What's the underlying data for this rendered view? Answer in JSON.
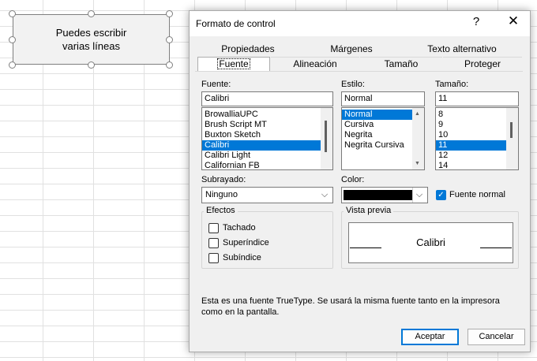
{
  "shape": {
    "text": "Puedes escribir\nvarias líneas"
  },
  "dialog": {
    "title": "Formato de control",
    "help": "?",
    "close": "✕",
    "tabs_row1": [
      "Propiedades",
      "Márgenes",
      "Texto alternativo"
    ],
    "tabs_row2": [
      "Fuente",
      "Alineación",
      "Tamaño",
      "Proteger"
    ],
    "font": {
      "label": "Fuente:",
      "value": "Calibri",
      "items": [
        "BrowalliaUPC",
        "Brush Script MT",
        "Buxton Sketch",
        "Calibri",
        "Calibri Light",
        "Californian FB"
      ],
      "selected": "Calibri"
    },
    "style": {
      "label": "Estilo:",
      "value": "Normal",
      "items": [
        "Normal",
        "Cursiva",
        "Negrita",
        "Negrita Cursiva"
      ],
      "selected": "Normal"
    },
    "size": {
      "label": "Tamaño:",
      "value": "11",
      "items": [
        "8",
        "9",
        "10",
        "11",
        "12",
        "14"
      ],
      "selected": "11"
    },
    "underline": {
      "label": "Subrayado:",
      "value": "Ninguno"
    },
    "color": {
      "label": "Color:",
      "swatch": "#000000"
    },
    "normal_font": {
      "label": "Fuente normal",
      "checked": true
    },
    "effects": {
      "title": "Efectos",
      "strike": "Tachado",
      "superscript": "Superíndice",
      "subscript": "Subíndice"
    },
    "preview": {
      "title": "Vista previa",
      "text": "Calibri"
    },
    "info_text": "Esta es una fuente TrueType. Se usará la misma fuente tanto en la impresora como en la pantalla.",
    "ok": "Aceptar",
    "cancel": "Cancelar"
  },
  "colors": {
    "accent": "#0078d7",
    "dialog_bg": "#f0f0f0"
  }
}
